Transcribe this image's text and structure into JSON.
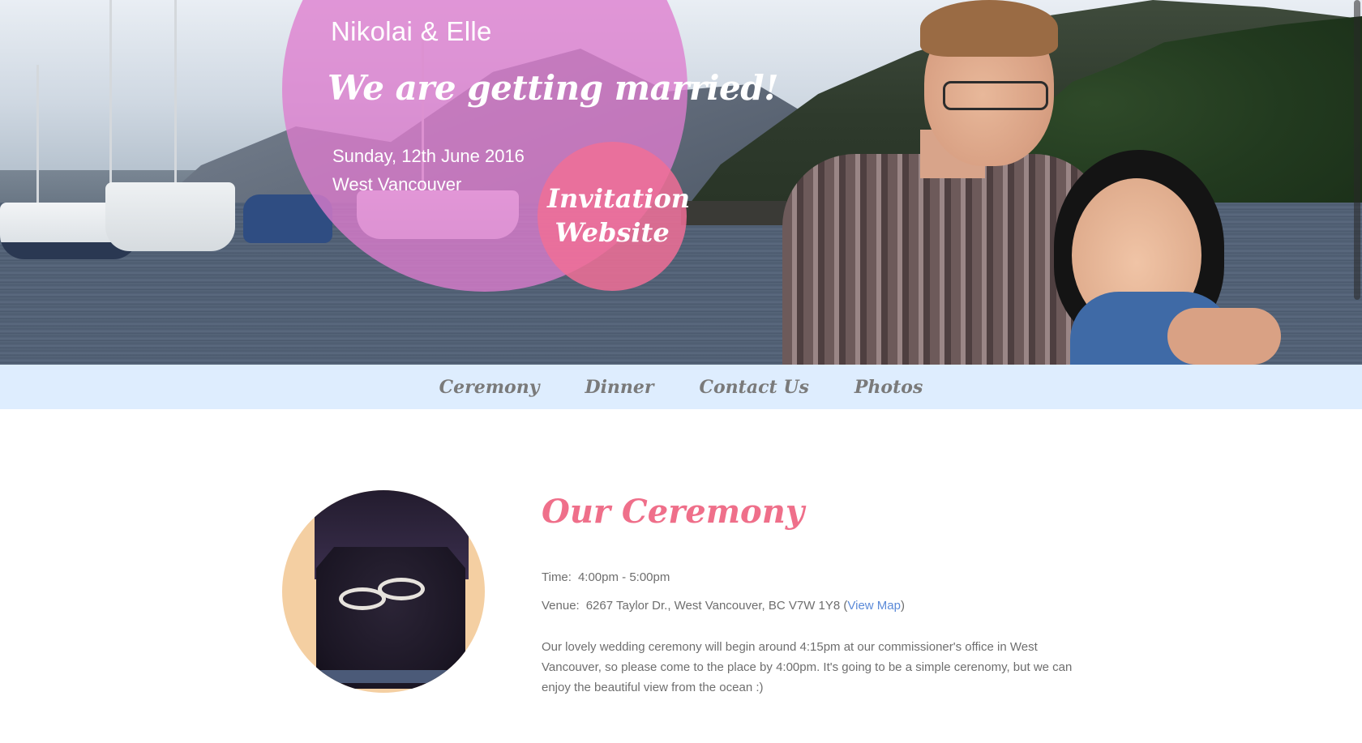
{
  "hero": {
    "names": "Nikolai & Elle",
    "headline": "We are getting married!",
    "date": "Sunday, 12th June 2016",
    "place": "West Vancouver",
    "badge": "Invitation Website"
  },
  "nav": {
    "items": [
      {
        "label": "Ceremony"
      },
      {
        "label": "Dinner"
      },
      {
        "label": "Contact Us"
      },
      {
        "label": "Photos"
      }
    ]
  },
  "ceremony": {
    "heading": "Our Ceremony",
    "time_label": "Time:",
    "time_value": "4:00pm - 5:00pm",
    "venue_label": "Venue:",
    "venue_value": "6267 Taylor Dr., West Vancouver, BC V7W 1Y8",
    "map_link": "View Map",
    "description": "Our lovely wedding ceremony will begin around 4:15pm at our commissioner's office in West Vancouver, so please come to the place by 4:00pm. It's going to be a simple cerenomy, but we can enjoy the beautiful view from the ocean :)"
  },
  "colors": {
    "nav_background": "#deedfe",
    "heading_pink": "#ef6f8a",
    "title_circle": "#de7cce",
    "badge_circle": "#f06e96",
    "link_blue": "#5b8ad8"
  }
}
